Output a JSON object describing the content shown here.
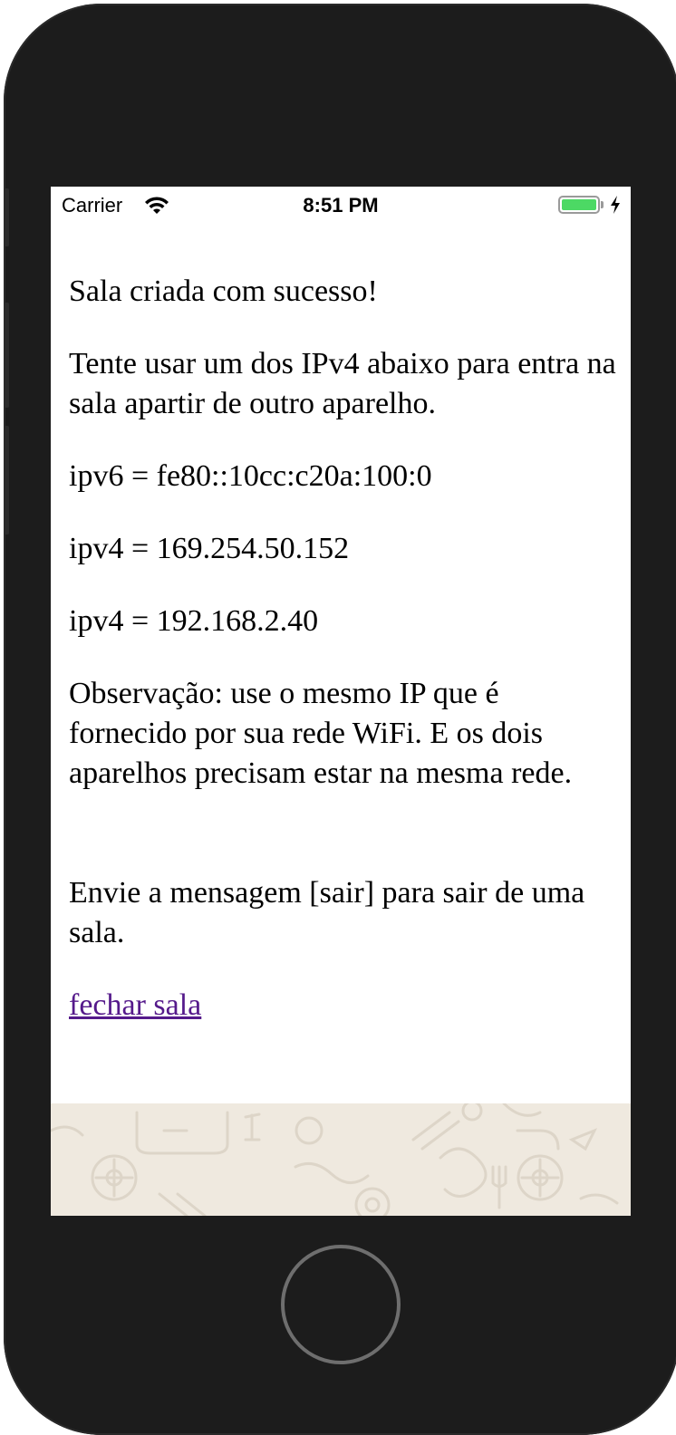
{
  "status_bar": {
    "carrier": "Carrier",
    "time": "8:51 PM",
    "wifi_icon": "wifi-icon",
    "battery_icon": "battery-icon",
    "charging_icon": "bolt-icon",
    "battery_color": "#4cd964"
  },
  "content": {
    "success_message": "Sala criada com sucesso!",
    "instructions": "Tente usar um dos IPv4 abaixo para entra na sala apartir de outro aparelho.",
    "addresses": [
      "ipv6 = fe80::10cc:c20a:100:0",
      "ipv4 = 169.254.50.152",
      "ipv4 = 192.168.2.40"
    ],
    "note": "Observação: use o mesmo IP que é fornecido por sua rede WiFi. E os dois aparelhos precisam estar na mesma rede.",
    "exit_hint": "Envie a mensagem [sair] para sair de uma sala.",
    "close_link": "fechar sala",
    "link_color": "#551a8b"
  },
  "background": {
    "pattern_color": "#efe9df"
  }
}
